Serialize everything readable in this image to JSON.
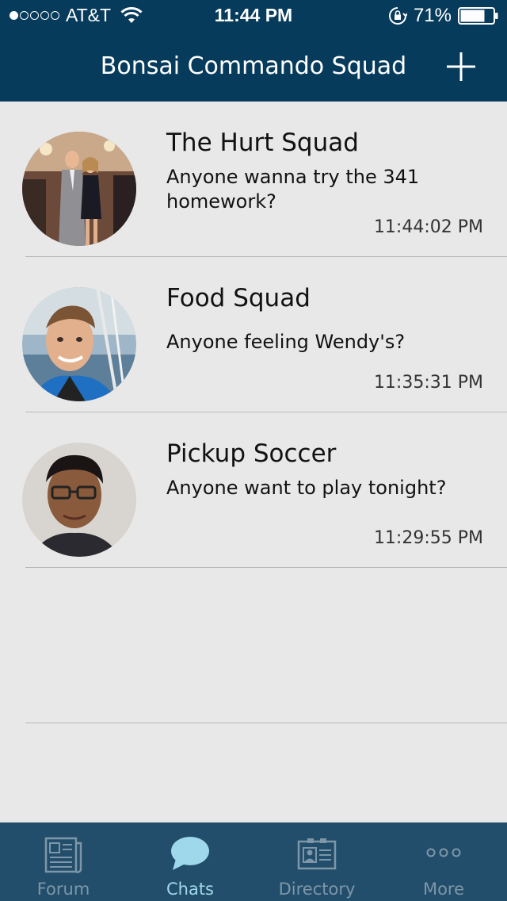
{
  "status_bar": {
    "carrier": "AT&T",
    "time": "11:44 PM",
    "battery": "71%",
    "signal_bars_filled": 1,
    "signal_bars_total": 5
  },
  "nav": {
    "title": "Bonsai Commando Squad",
    "add_icon": "plus-icon"
  },
  "chats": [
    {
      "name": "The Hurt Squad",
      "message": "Anyone wanna try the 341 homework?",
      "time": "11:44:02 PM",
      "avatar": "couple-photo"
    },
    {
      "name": "Food Squad",
      "message": "Anyone feeling Wendy's?",
      "time": "11:35:31 PM",
      "avatar": "boat-selfie-photo"
    },
    {
      "name": "Pickup Soccer",
      "message": "Anyone want to play tonight?",
      "time": "11:29:55 PM",
      "avatar": "glasses-portrait-photo"
    }
  ],
  "tabs": [
    {
      "label": "Forum",
      "icon": "newspaper-icon",
      "active": false
    },
    {
      "label": "Chats",
      "icon": "chat-bubble-icon",
      "active": true
    },
    {
      "label": "Directory",
      "icon": "contact-card-icon",
      "active": false
    },
    {
      "label": "More",
      "icon": "more-dots-icon",
      "active": false
    }
  ],
  "colors": {
    "header_bg": "#073b5c",
    "tab_bar_bg": "#234e6b",
    "active_tab": "#9fd8ea",
    "inactive_tab": "#7d96a8",
    "list_bg": "#e8e8e8"
  }
}
